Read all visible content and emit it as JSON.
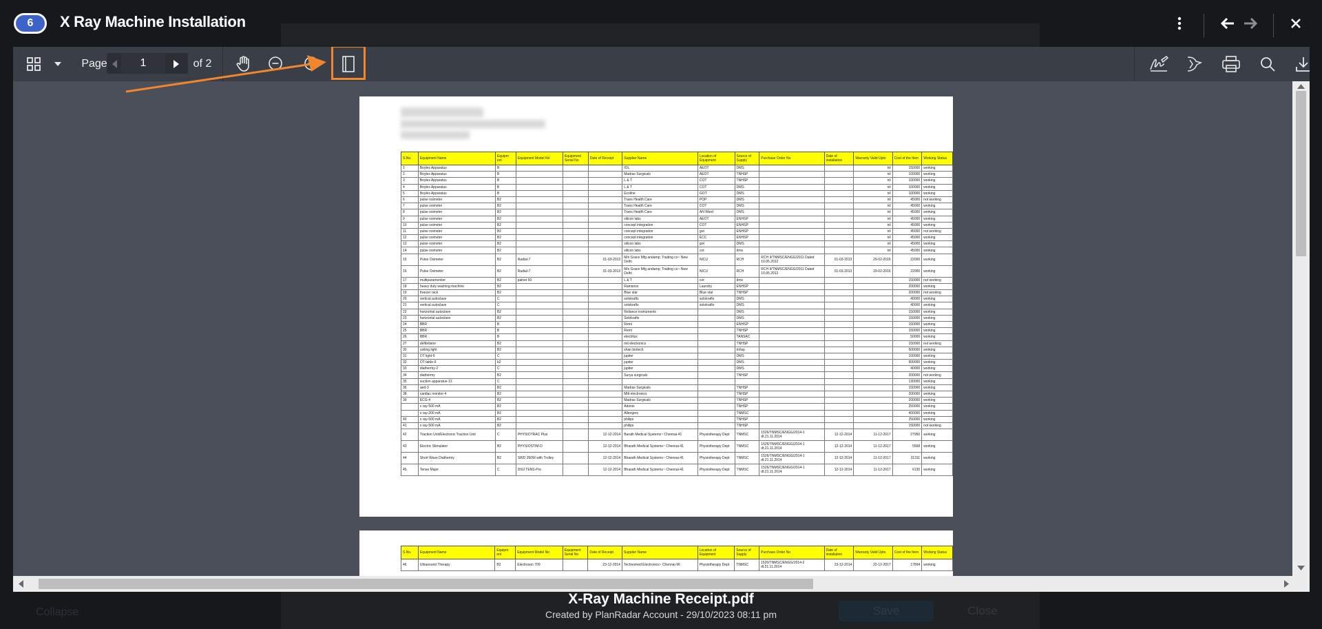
{
  "header": {
    "count": "6",
    "title": "X Ray Machine Installation"
  },
  "toolbar": {
    "page_label": "Page",
    "page_value": "1",
    "page_total": "of 2"
  },
  "document": {
    "headers": [
      "S.No.",
      "Equipment Name",
      "Equipm ent",
      "Equipment Model No",
      "Equipment Serial No",
      "Date of Receipt",
      "Supplier Name",
      "Location of Equipment",
      "Source of Supply",
      "Purchase Order No",
      "Date of installation",
      "Warranty Valid Upto",
      "Cost of the Item",
      "Working Status"
    ],
    "rows": [
      [
        "1",
        "Boyles Apparatus",
        "B",
        "",
        "",
        "",
        "IOL",
        "AEOT",
        "DMS",
        "",
        "",
        "nil",
        "150000",
        "working"
      ],
      [
        "2",
        "Boyles Apparatus",
        "B",
        "",
        "",
        "",
        "Madras Surgicals",
        "AEOT",
        "TNHSP",
        "",
        "",
        "nil",
        "100000",
        "working"
      ],
      [
        "3",
        "Boyles Apparatus",
        "B",
        "",
        "",
        "",
        "L & T",
        "COT",
        "TNHSP",
        "",
        "",
        "nil",
        "100000",
        "working"
      ],
      [
        "4",
        "Boyles Apparatus",
        "B",
        "",
        "",
        "",
        "L & T",
        "COT",
        "DMS",
        "",
        "",
        "nil",
        "100000",
        "working"
      ],
      [
        "5",
        "Boyles Apparatus",
        "B",
        "",
        "",
        "",
        "Ecoline",
        "GOT",
        "DMS",
        "",
        "",
        "nil",
        "100000",
        "working"
      ],
      [
        "6",
        "pulse oximeter",
        "B2",
        "",
        "",
        "",
        "Trans Health Care",
        "POP",
        "DMS",
        "",
        "",
        "nil",
        "45000",
        "not working"
      ],
      [
        "7",
        "pulse oximeter",
        "B2",
        "",
        "",
        "",
        "Trans Health Care",
        "COT",
        "DMS",
        "",
        "",
        "nil",
        "45000",
        "working"
      ],
      [
        "8",
        "pulse oximeter",
        "B2",
        "",
        "",
        "",
        "Trans Health Care",
        "AN Ward",
        "DMS",
        "",
        "",
        "nil",
        "45000",
        "working"
      ],
      [
        "9",
        "pulse oximeter",
        "B2",
        "",
        "",
        "",
        "silicon labs",
        "AEOT",
        "ENHSP",
        "",
        "",
        "nil",
        "45000",
        "working"
      ],
      [
        "10",
        "pulse oximeter",
        "B2",
        "",
        "",
        "",
        "concept integration",
        "COT",
        "ENHSP",
        "",
        "",
        "nil",
        "45000",
        "working"
      ],
      [
        "11",
        "pulse oximeter",
        "B2",
        "",
        "",
        "",
        "concept integration",
        "got",
        "ENHSP",
        "",
        "",
        "nil",
        "45000",
        "not working"
      ],
      [
        "12",
        "pulse oximeter",
        "B2",
        "",
        "",
        "",
        "concept integration",
        "ECC",
        "ENHSP",
        "",
        "",
        "nil",
        "45000",
        "working"
      ],
      [
        "13",
        "pulse oximeter",
        "B2",
        "",
        "",
        "",
        "silicon labs",
        "got",
        "DMS",
        "",
        "",
        "nil",
        "45000",
        "working"
      ],
      [
        "14",
        "pulse oximeter",
        "B2",
        "",
        "",
        "",
        "silicon labs",
        "cot",
        "dms",
        "",
        "",
        "nil",
        "45000",
        "working"
      ],
      [
        "15",
        "Pulse Oximeter",
        "B2",
        "Radial-7",
        "",
        "01-03-2013",
        "M/s Grace Mfg andamp; Trading co~ New Delhi",
        "NICU",
        "RCH",
        "RCH II/TNMSC/ENGG/2011 Dated 10.05.2012",
        "01-03-2013",
        "29-02-2016",
        "22000",
        "working"
      ],
      [
        "16",
        "Pulse Oximeter",
        "B2",
        "Radial-7",
        "",
        "01-03-2013",
        "M/s Grace Mfg andamp; Trading co~ New Delhi",
        "NICU",
        "RCH",
        "RCH II/TNMSC/ENGG/2011 Dated 10.05.2012",
        "01-03-2013",
        "29-02-2016",
        "22000",
        "working"
      ],
      [
        "17",
        "multiparamonitor",
        "B2",
        "palnet 50",
        "",
        "",
        "L & T",
        "cot",
        "dms",
        "",
        "",
        "",
        "150000",
        "not working"
      ],
      [
        "18",
        "heavy duty washing machine",
        "B2",
        "",
        "",
        "",
        "Ramsons",
        "Laundry",
        "ENHSP",
        "",
        "",
        "",
        "200000",
        "working"
      ],
      [
        "19",
        "freezer rack",
        "B2",
        "",
        "",
        "",
        "Blue star",
        "Blue star",
        "TNHSP",
        "",
        "",
        "",
        "200000",
        "not working"
      ],
      [
        "20",
        "vertical autoclave",
        "C",
        "",
        "",
        "",
        "solokrafts",
        "solokrafts",
        "DMS",
        "",
        "",
        "",
        "40000",
        "working"
      ],
      [
        "21",
        "vertical autoclave",
        "C",
        "",
        "",
        "",
        "solokrafts",
        "solokrafts",
        "DMS",
        "",
        "",
        "",
        "40000",
        "working"
      ],
      [
        "22",
        "horizontal autoclave",
        "B2",
        "",
        "",
        "",
        "Reliance instruments",
        "",
        "DMS",
        "",
        "",
        "",
        "150000",
        "working"
      ],
      [
        "23",
        "horizontal autoclave",
        "B2",
        "",
        "",
        "",
        "Solokrafts",
        "",
        "DMS",
        "",
        "",
        "",
        "150000",
        "working"
      ],
      [
        "24",
        "BBR",
        "B",
        "",
        "",
        "",
        "Remi",
        "",
        "ENHSP",
        "",
        "",
        "",
        "150000",
        "working"
      ],
      [
        "25",
        "BBR",
        "B",
        "",
        "",
        "",
        "Remi",
        "",
        "TNHSP",
        "",
        "",
        "",
        "150000",
        "working"
      ],
      [
        "26",
        "BBR",
        "B",
        "",
        "",
        "",
        "electrilux",
        "",
        "TANSAC",
        "",
        "",
        "",
        "50000",
        "working"
      ],
      [
        "27",
        "defibrilator",
        "B2",
        "",
        "",
        "",
        "mit electronics",
        "",
        "TNHSP",
        "",
        "",
        "",
        "150000",
        "not working"
      ],
      [
        "30",
        "ceiling light",
        "B2",
        "",
        "",
        "",
        "shan biotech",
        "",
        "tnhsp",
        "",
        "",
        "",
        "500000",
        "working"
      ],
      [
        "31",
        "OT light-5",
        "C",
        "",
        "",
        "",
        "jupiter",
        "",
        "DMS",
        "",
        "",
        "",
        "100000",
        "working"
      ],
      [
        "32",
        "OT table-9",
        "b2",
        "",
        "",
        "",
        "jupiter",
        "",
        "DMS",
        "",
        "",
        "",
        "900000",
        "working"
      ],
      [
        "33",
        "diathermy-2",
        "C",
        "",
        "",
        "",
        "jupiter",
        "",
        "DMS",
        "",
        "",
        "",
        "40000",
        "working"
      ],
      [
        "34",
        "diathermy",
        "B2",
        "",
        "",
        "",
        "Surya surgicals",
        "",
        "TNHSP",
        "",
        "",
        "",
        "200000",
        "not working"
      ],
      [
        "35",
        "suction apparatus-13",
        "C",
        "",
        "",
        "",
        "",
        "",
        "",
        "",
        "",
        "",
        "130000",
        "working"
      ],
      [
        "36",
        "aed-3",
        "B2",
        "",
        "",
        "",
        "Madras Surgicals",
        "",
        "TNHSP",
        "",
        "",
        "",
        "150000",
        "working"
      ],
      [
        "38",
        "cardiac monitor-4",
        "B2",
        "",
        "",
        "",
        "Mitt electronics",
        "",
        "TNHSP",
        "",
        "",
        "",
        "200000",
        "working"
      ],
      [
        "39",
        "ECG-4",
        "B2",
        "",
        "",
        "",
        "Madras Surgicals",
        "",
        "TNHSP",
        "",
        "",
        "",
        "200000",
        "working"
      ],
      [
        "",
        "x ray-500 mA",
        "B2",
        "",
        "",
        "",
        "Adonis",
        "",
        "TNHSP",
        "",
        "",
        "",
        "250000",
        "working"
      ],
      [
        "",
        "x ray-200 mA",
        "B2",
        "",
        "",
        "",
        "Allengers",
        "",
        "TNMSC",
        "",
        "",
        "",
        "400000",
        "working"
      ],
      [
        "40",
        "x ray-500 mA",
        "B2",
        "",
        "",
        "",
        "philips",
        "",
        "TNHSP",
        "",
        "",
        "",
        "250000",
        "working"
      ],
      [
        "41",
        "x ray-500 mA",
        "B2",
        "",
        "",
        "",
        "philips",
        "",
        "TNHSP",
        "",
        "",
        "",
        "150000",
        "not working"
      ],
      [
        "42",
        "Traction Unit/Electronic Traction Unit",
        "C",
        "PHYSIOTRAC Plus",
        "",
        "12-12-2014",
        "Barath Medical Systems~ Chennai-41",
        "Physiotherapy Dept",
        "TNMSC",
        "1526/TNMSC/ENGG/2014-1 dt.21.11.2014",
        "12-12-2014",
        "11-12-2017",
        "27950",
        "working"
      ],
      [
        "43",
        "Electric Stimulator",
        "B2",
        "PHYSIOSTIM-D",
        "",
        "12-12-2014",
        "Bharath Medical Systems~ Chennai-41",
        "Physiotherapy Dept",
        "TNMSC",
        "1526/TNMSC/ENGG/2014-1 dt.21.11.2014",
        "12-12-2014",
        "11-12-2017",
        "5568",
        "working"
      ],
      [
        "44",
        "Short Wave Diathermy",
        "B2",
        "SWD 350W with Trolley",
        "",
        "12-12-2014",
        "Bharath Medical Systems~ Chennai-41",
        "Physiotherapy Dept",
        "TNMSC",
        "1526/TNMSC/ENGG/2014-1 dt.21.11.2014",
        "12-12-2014",
        "11-12-2017",
        "31311",
        "working"
      ],
      [
        "45",
        "Tense Major",
        "C",
        "DIGI TENS-Pro",
        "",
        "12-12-2014",
        "Bharath Medical Systems~ Chennai-41",
        "Physiotherapy Dept",
        "TNMSC",
        "1526/TNMSC/ENGG/2014-1 dt.21.11.2014",
        "12-12-2014",
        "11-12-2017",
        "6130",
        "working"
      ]
    ],
    "page2_rows": [
      [
        "46",
        "Ultrasound Therapy",
        "B2",
        "Electroson 709",
        "",
        "23-12-2014",
        "Technomed Electronics~ Chennai-96",
        "Physiotherapy Dept",
        "TNMSC",
        "1526/TNMSC/ENGG/2014-2 dt.21.11.2014",
        "23-12-2014",
        "22-12-2017",
        "17894",
        "working"
      ]
    ]
  },
  "footer": {
    "file_name": "X-Ray Machine Receipt.pdf",
    "meta": "Created by PlanRadar Account - 29/10/2023 08:11 pm"
  },
  "background": {
    "save_label": "Save",
    "close_label": "Close",
    "collapse_label": "Collapse"
  },
  "colors": {
    "accent_orange": "#f0862e",
    "badge_blue": "#3d62c8",
    "table_header_yellow": "#ffff00"
  }
}
